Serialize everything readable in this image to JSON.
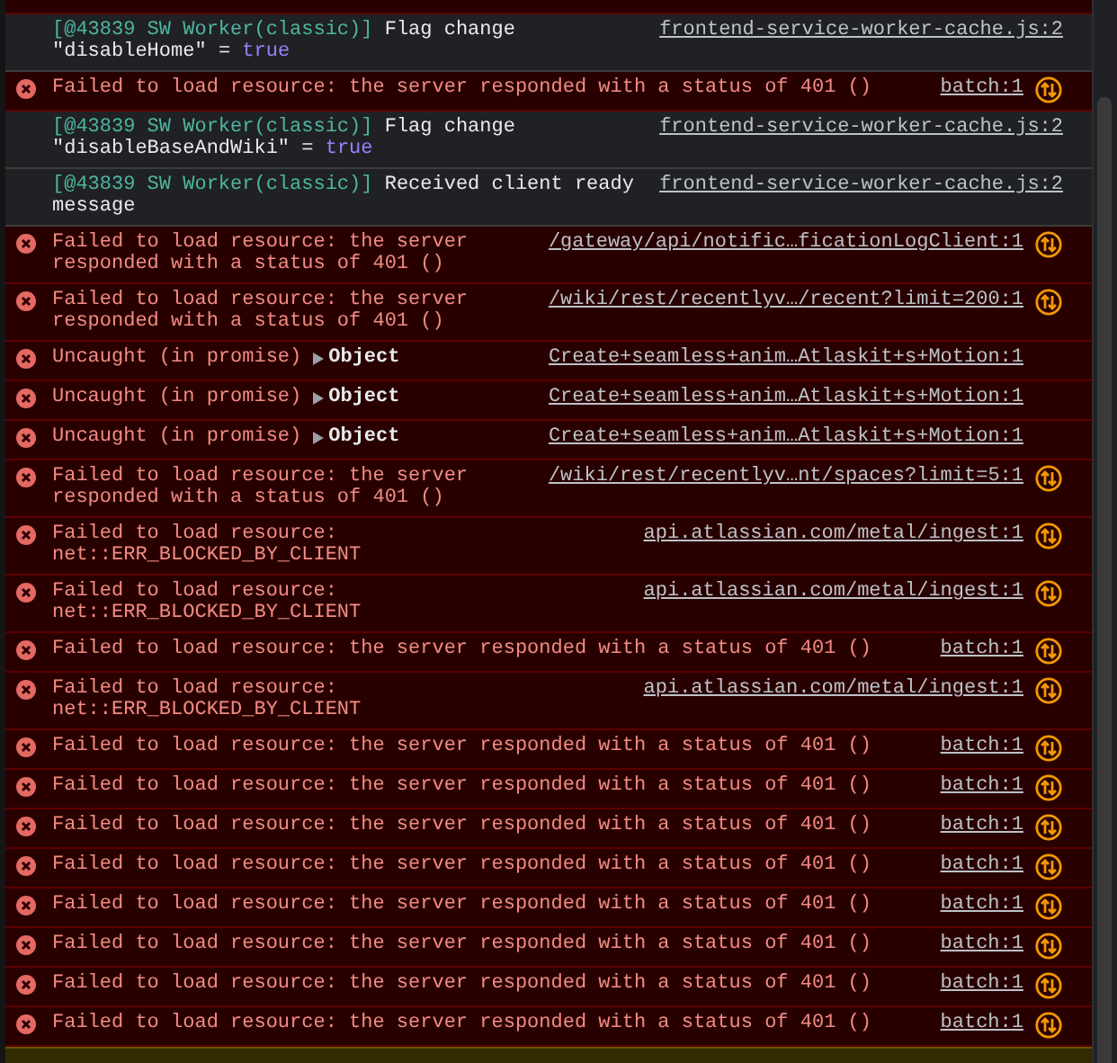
{
  "rows": [
    {
      "kind": "info",
      "prefix": "[@43839 SW Worker(classic)]",
      "message": "Flag change",
      "key": "\"disableHome\"",
      "operator": "=",
      "value": "true",
      "source": "frontend-service-worker-cache.js:2"
    },
    {
      "kind": "error",
      "message": "Failed to load resource: the server responded with a status of 401 ()",
      "source": "batch:1"
    },
    {
      "kind": "info",
      "prefix": "[@43839 SW Worker(classic)]",
      "message": "Flag change",
      "key": "\"disableBaseAndWiki\"",
      "operator": "=",
      "value": "true",
      "source": "frontend-service-worker-cache.js:2"
    },
    {
      "kind": "info",
      "prefix": "[@43839 SW Worker(classic)]",
      "message": "Received client ready\nmessage",
      "source": "frontend-service-worker-cache.js:2"
    },
    {
      "kind": "error",
      "message": "Failed to load resource: the server\nresponded with a status of 401 ()",
      "source": "/gateway/api/notific…ficationLogClient:1"
    },
    {
      "kind": "error",
      "message": "Failed to load resource: the server\nresponded with a status of 401 ()",
      "source": "/wiki/rest/recentlyv…/recent?limit=200:1"
    },
    {
      "kind": "uncaught",
      "message": "Uncaught (in promise)",
      "object_label": "Object",
      "expanded": false,
      "source": "Create+seamless+anim…Atlaskit+s+Motion:1"
    },
    {
      "kind": "uncaught",
      "message": "Uncaught (in promise)",
      "object_label": "Object",
      "expanded": false,
      "source": "Create+seamless+anim…Atlaskit+s+Motion:1"
    },
    {
      "kind": "uncaught",
      "message": "Uncaught (in promise)",
      "object_label": "Object",
      "expanded": false,
      "source": "Create+seamless+anim…Atlaskit+s+Motion:1"
    },
    {
      "kind": "error",
      "message": "Failed to load resource: the server\nresponded with a status of 401 ()",
      "source": "/wiki/rest/recentlyv…nt/spaces?limit=5:1"
    },
    {
      "kind": "error",
      "message": "Failed to load resource:\nnet::ERR_BLOCKED_BY_CLIENT",
      "source": "api.atlassian.com/metal/ingest:1"
    },
    {
      "kind": "error",
      "message": "Failed to load resource:\nnet::ERR_BLOCKED_BY_CLIENT",
      "source": "api.atlassian.com/metal/ingest:1"
    },
    {
      "kind": "error",
      "message": "Failed to load resource: the server responded with a status of 401 ()",
      "source": "batch:1"
    },
    {
      "kind": "error",
      "message": "Failed to load resource:\nnet::ERR_BLOCKED_BY_CLIENT",
      "source": "api.atlassian.com/metal/ingest:1"
    },
    {
      "kind": "error",
      "message": "Failed to load resource: the server responded with a status of 401 ()",
      "source": "batch:1"
    },
    {
      "kind": "error",
      "message": "Failed to load resource: the server responded with a status of 401 ()",
      "source": "batch:1"
    },
    {
      "kind": "error",
      "message": "Failed to load resource: the server responded with a status of 401 ()",
      "source": "batch:1"
    },
    {
      "kind": "error",
      "message": "Failed to load resource: the server responded with a status of 401 ()",
      "source": "batch:1"
    },
    {
      "kind": "error",
      "message": "Failed to load resource: the server responded with a status of 401 ()",
      "source": "batch:1"
    },
    {
      "kind": "error",
      "message": "Failed to load resource: the server responded with a status of 401 ()",
      "source": "batch:1"
    },
    {
      "kind": "error",
      "message": "Failed to load resource: the server responded with a status of 401 ()",
      "source": "batch:1"
    },
    {
      "kind": "error",
      "message": "Failed to load resource: the server responded with a status of 401 ()",
      "source": "batch:1"
    }
  ]
}
